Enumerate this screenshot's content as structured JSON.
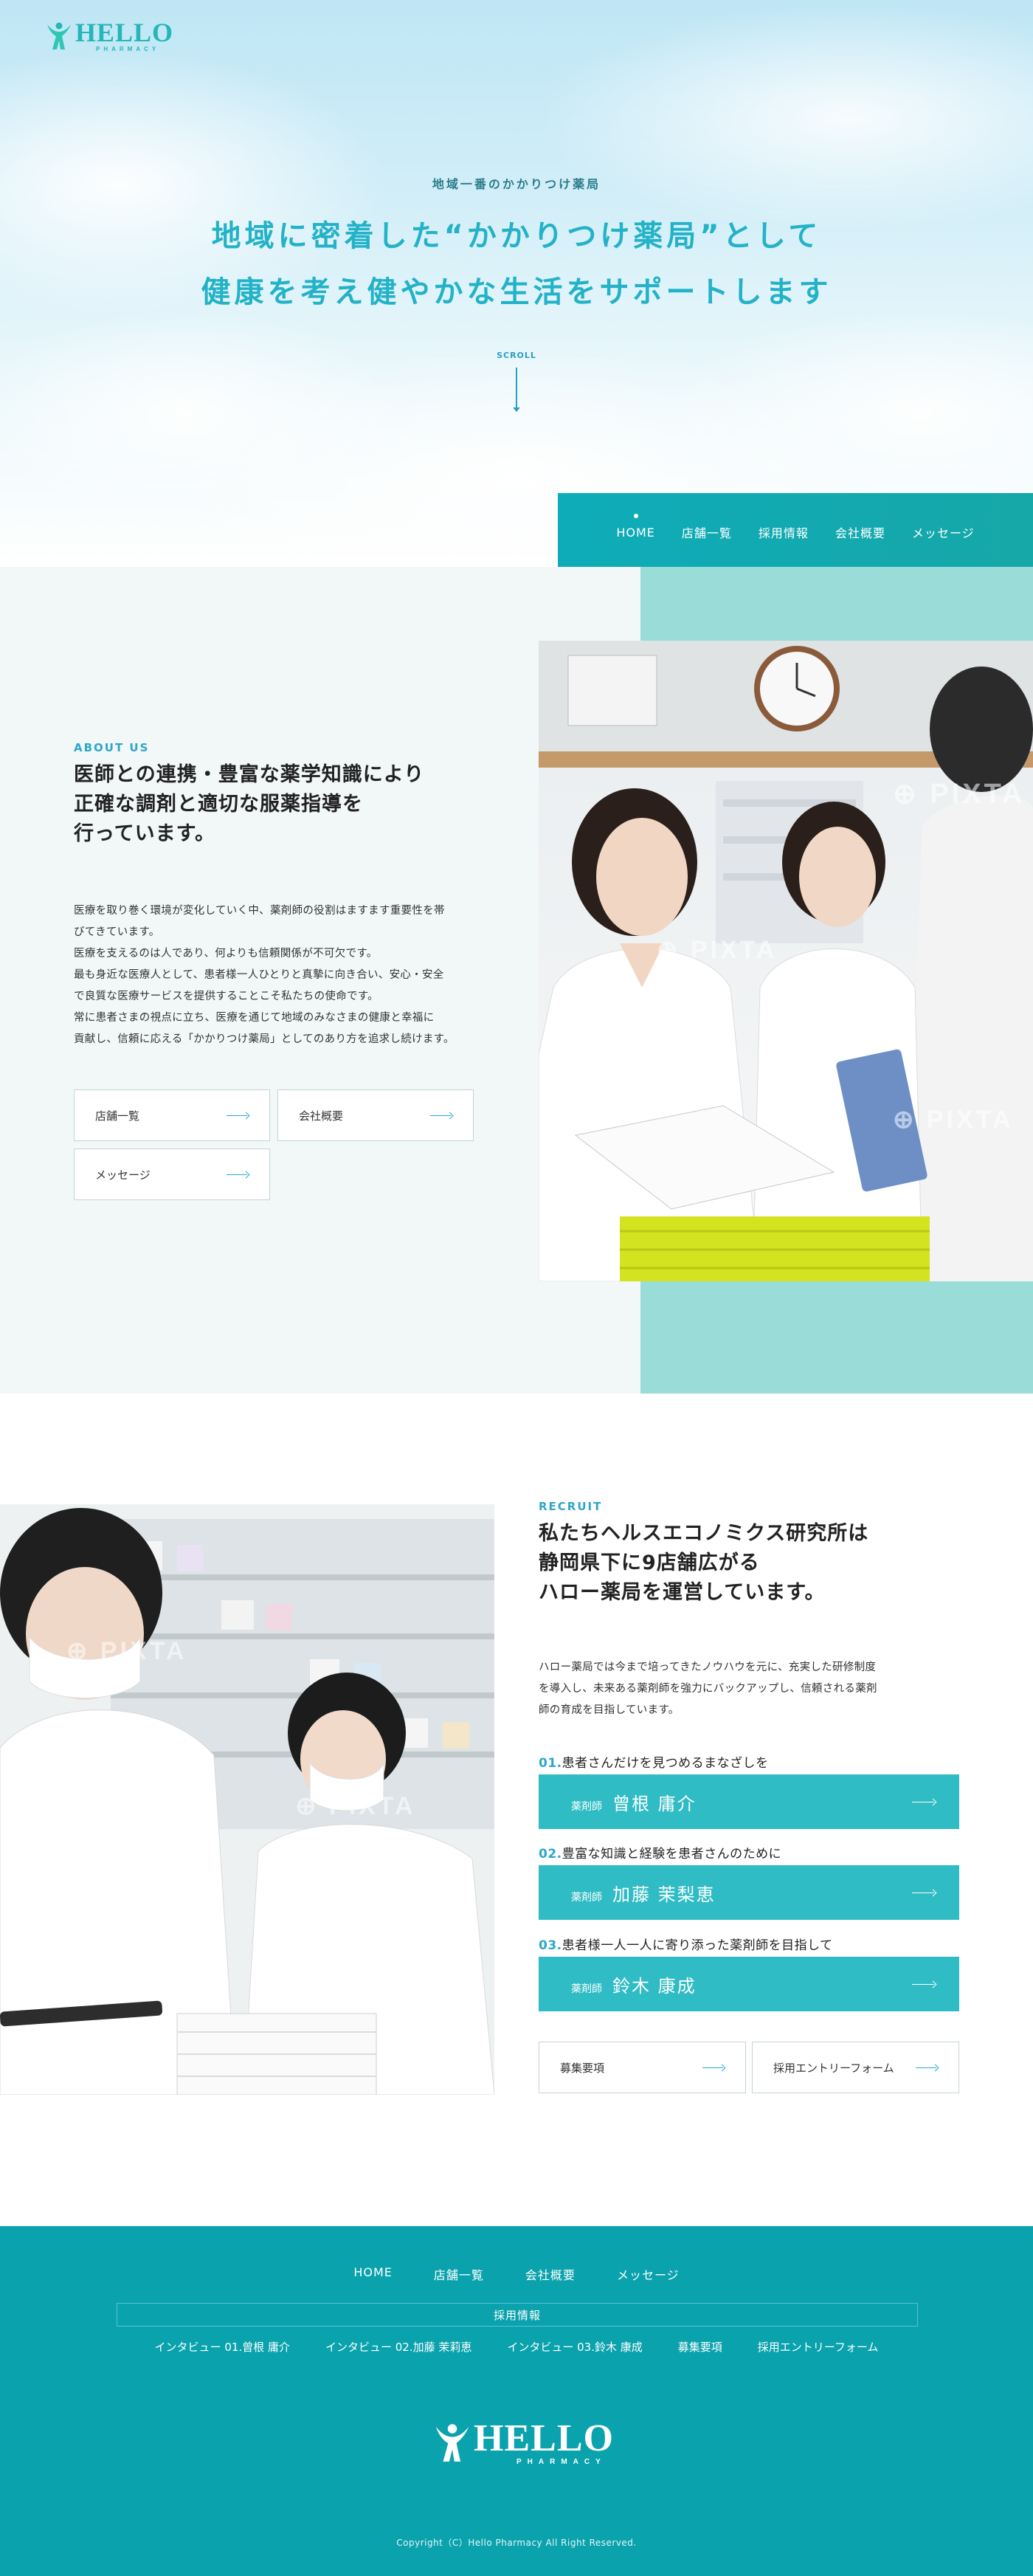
{
  "colors": {
    "brand_teal": "#0aa2ad",
    "accent_cyan": "#23b2c7",
    "mint_panel": "#9adcd8",
    "interview_button": "#2fbcc4"
  },
  "logo": {
    "main": "HELLO",
    "sub": "PHARMACY",
    "icon": "person-raising-arms-icon"
  },
  "hero": {
    "eyebrow": "地域一番のかかりつけ薬局",
    "title_line1": "地域に密着した“かかりつけ薬局”として",
    "title_line2": "健康を考え健やかな生活をサポートします",
    "scroll": "SCROLL"
  },
  "nav": {
    "items": [
      {
        "label": "HOME"
      },
      {
        "label": "店舗一覧"
      },
      {
        "label": "採用情報"
      },
      {
        "label": "会社概要"
      },
      {
        "label": "メッセージ"
      }
    ]
  },
  "about": {
    "label": "ABOUT US",
    "heading_line1": "医師との連携・豊富な薬学知識により",
    "heading_line2": "正確な調剤と適切な服薬指導を",
    "heading_line3": "行っています。",
    "body": [
      "医療を取り巻く環境が変化していく中、薬剤師の役割はますます重要性を帯",
      "びてきています。",
      "医療を支えるのは人であり、何よりも信頼関係が不可欠です。",
      "最も身近な医療人として、患者様一人ひとりと真摯に向き合い、安心・安全",
      "で良質な医療サービスを提供することこそ私たちの使命です。",
      "常に患者さまの視点に立ち、医療を通じて地域のみなさまの健康と幸福に",
      "貢献し、信頼に応える「かかりつけ薬局」としてのあり方を追求し続けます。"
    ],
    "buttons": {
      "stores": "店舗一覧",
      "company": "会社概要",
      "message": "メッセージ"
    },
    "photo_watermark": "PIXTA"
  },
  "recruit": {
    "label": "RECRUIT",
    "heading_line1": "私たちヘルスエコノミクス研究所は",
    "heading_line2": "静岡県下に9店舗広がる",
    "heading_line3": "ハロー薬局を運営しています。",
    "body": [
      "ハロー薬局では今まで培ってきたノウハウを元に、充実した研修制度",
      "を導入し、未来ある薬剤師を強力にバックアップし、信頼される薬剤",
      "師の育成を目指しています。"
    ],
    "interviews": [
      {
        "num": "01.",
        "lead": "患者さんだけを見つめるまなざしを",
        "role": "薬剤師",
        "name": "曾根 庸介"
      },
      {
        "num": "02.",
        "lead": "豊富な知識と経験を患者さんのために",
        "role": "薬剤師",
        "name": "加藤 茉梨恵"
      },
      {
        "num": "03.",
        "lead": "患者様一人一人に寄り添った薬剤師を目指して",
        "role": "薬剤師",
        "name": "鈴木 康成"
      }
    ],
    "buttons": {
      "jobs": "募集要項",
      "entry": "採用エントリーフォーム"
    },
    "photo_watermark": "PIXTA"
  },
  "footer": {
    "nav": [
      "HOME",
      "店舗一覧",
      "会社概要",
      "メッセージ"
    ],
    "recruit_title": "採用情報",
    "sub": [
      "インタビュー 01.曾根 庸介",
      "インタビュー 02.加藤 茉莉恵",
      "インタビュー 03.鈴木 康成",
      "募集要項",
      "採用エントリーフォーム"
    ],
    "copyright": "Copyright（C）Hello Pharmacy All Right Reserved."
  }
}
